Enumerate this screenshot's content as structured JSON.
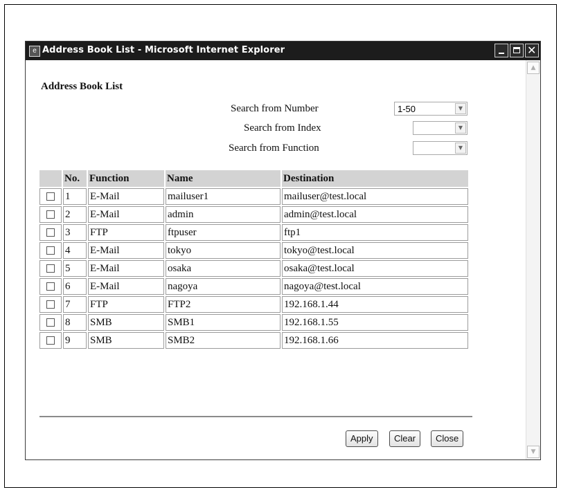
{
  "window": {
    "title": "Address Book List - Microsoft Internet Explorer",
    "icon": "ie-page-icon"
  },
  "page": {
    "title": "Address Book List"
  },
  "search": {
    "number_label": "Search from Number",
    "number_value": "1-50",
    "index_label": "Search from Index",
    "index_value": "",
    "function_label": "Search from Function",
    "function_value": ""
  },
  "table": {
    "headers": [
      "",
      "No.",
      "Function",
      "Name",
      "Destination"
    ],
    "rows": [
      {
        "no": "1",
        "function": "E-Mail",
        "name": "mailuser1",
        "destination": "mailuser@test.local",
        "checked": false
      },
      {
        "no": "2",
        "function": "E-Mail",
        "name": "admin",
        "destination": "admin@test.local",
        "checked": false
      },
      {
        "no": "3",
        "function": "FTP",
        "name": "ftpuser",
        "destination": "ftp1",
        "checked": false
      },
      {
        "no": "4",
        "function": "E-Mail",
        "name": "tokyo",
        "destination": "tokyo@test.local",
        "checked": false
      },
      {
        "no": "5",
        "function": "E-Mail",
        "name": "osaka",
        "destination": "osaka@test.local",
        "checked": false
      },
      {
        "no": "6",
        "function": "E-Mail",
        "name": "nagoya",
        "destination": "nagoya@test.local",
        "checked": false
      },
      {
        "no": "7",
        "function": "FTP",
        "name": "FTP2",
        "destination": "192.168.1.44",
        "checked": false
      },
      {
        "no": "8",
        "function": "SMB",
        "name": "SMB1",
        "destination": "192.168.1.55",
        "checked": false
      },
      {
        "no": "9",
        "function": "SMB",
        "name": "SMB2",
        "destination": "192.168.1.66",
        "checked": false
      }
    ]
  },
  "buttons": {
    "apply": "Apply",
    "clear": "Clear",
    "close": "Close"
  },
  "colors": {
    "titlebar": "#1c1c1c",
    "header_bg": "#d3d3d3"
  }
}
